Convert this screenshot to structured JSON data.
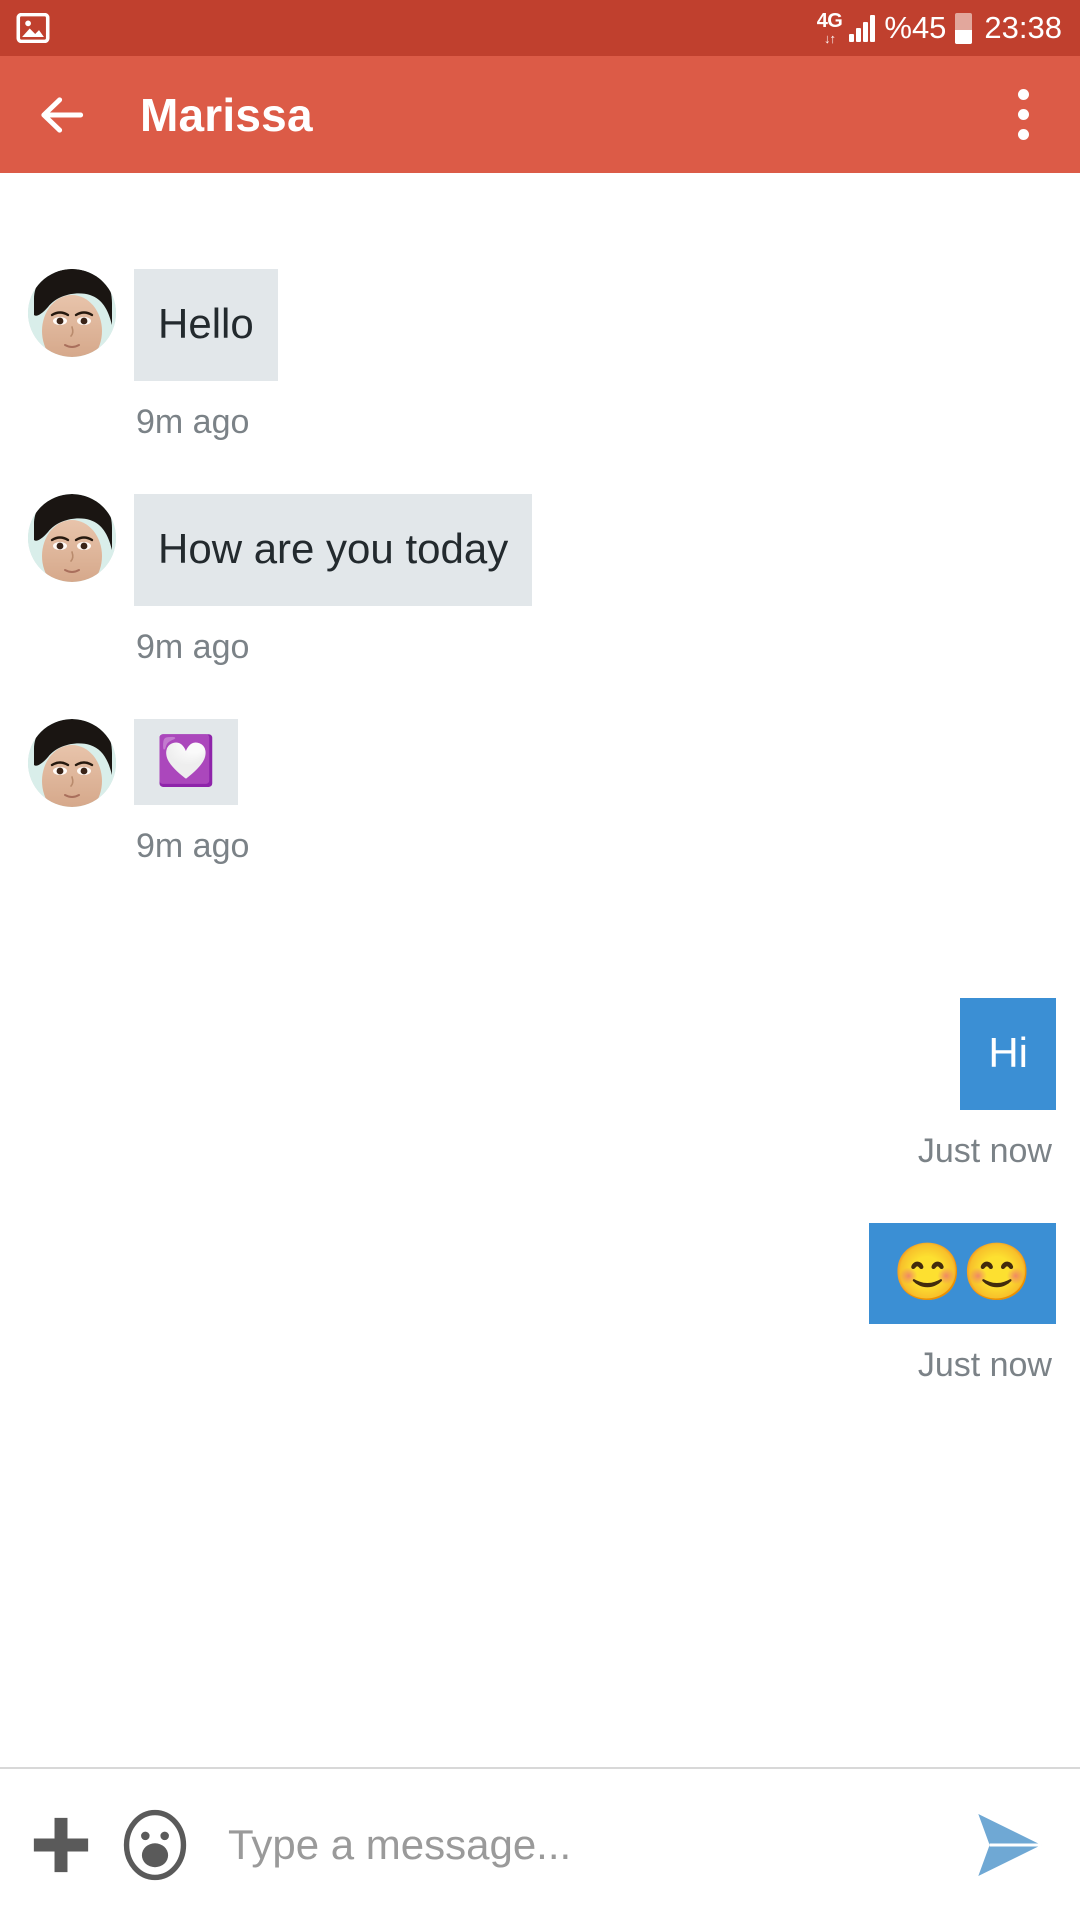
{
  "status_bar": {
    "notification_icon": "photo-icon",
    "network_type": "4G",
    "data_arrows": "↓↑",
    "signal_icon": "signal-bars-icon",
    "battery_text": "%45",
    "battery_icon": "battery-icon",
    "battery_level_percent": 45,
    "time": "23:38",
    "background_color": "#c0402e"
  },
  "app_bar": {
    "back_icon": "back-arrow-icon",
    "title": "Marissa",
    "overflow_icon": "overflow-menu-icon",
    "background_color": "#dc5b47"
  },
  "conversation": {
    "messages": [
      {
        "direction": "in",
        "type": "text",
        "avatar": "contact-avatar",
        "text": "Hello",
        "time": "9m ago"
      },
      {
        "direction": "in",
        "type": "text",
        "avatar": "contact-avatar",
        "text": "How are you today",
        "time": "9m ago"
      },
      {
        "direction": "in",
        "type": "sticker",
        "avatar": "contact-avatar",
        "text": "💟",
        "time": "9m ago"
      },
      {
        "direction": "out",
        "type": "text",
        "text": "Hi",
        "time": "Just now"
      },
      {
        "direction": "out",
        "type": "emoji",
        "text": "😊😊",
        "time": "Just now"
      }
    ],
    "incoming_bubble_color": "#e2e7ea",
    "outgoing_bubble_color": "#3b8fd4",
    "timestamp_color": "#7b8287"
  },
  "input_bar": {
    "attach_icon": "plus-icon",
    "emoji_icon": "emoji-face-icon",
    "placeholder": "Type a message...",
    "value": "",
    "send_icon": "send-icon",
    "send_color": "#6fa8d4"
  }
}
